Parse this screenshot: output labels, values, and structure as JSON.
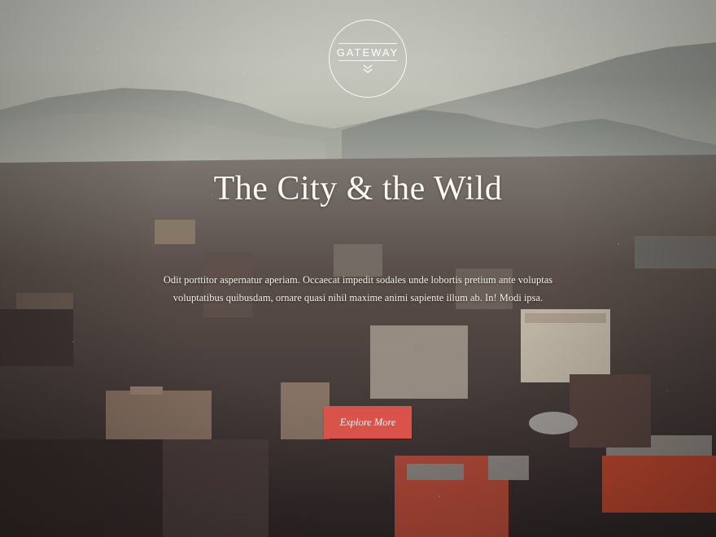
{
  "brand": {
    "name": "GATEWAY",
    "logo_icon": "chevron-double-down-icon"
  },
  "hero": {
    "title": "The City & the Wild",
    "description": "Odit porttitor aspernatur aperiam. Occaecat impedit sodales unde lobortis pretium ante voluptas voluptatibus quibusdam, ornare quasi nihil maxime animi sapiente illum ab. In! Modi ipsa.",
    "cta_label": "Explore More"
  },
  "colors": {
    "cta_background": "#d9534a",
    "text": "#fbf8f2",
    "sky": "#cfd0c8"
  }
}
